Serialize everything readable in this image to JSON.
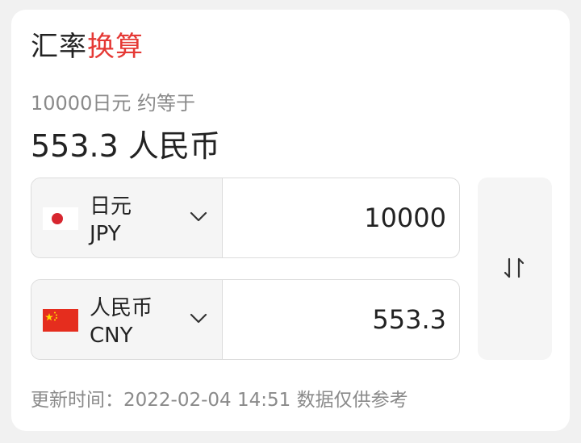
{
  "header": {
    "title_prefix": "汇率",
    "title_highlight": "换算"
  },
  "summary": {
    "description": "10000日元 约等于",
    "result": "553.3 人民币"
  },
  "converter": {
    "from": {
      "name": "日元",
      "code": "JPY",
      "amount": "10000",
      "flag": "japan-flag-icon"
    },
    "to": {
      "name": "人民币",
      "code": "CNY",
      "amount": "553.3",
      "flag": "china-flag-icon"
    },
    "swap_icon": "swap-arrows-icon"
  },
  "footer": {
    "label": "更新时间：",
    "timestamp": "2022-02-04 14:51",
    "note": "数据仅供参考"
  },
  "colors": {
    "accent": "#e53935",
    "text": "#222222",
    "muted": "#8a8a8a",
    "border": "#dcdcdc",
    "panel": "#f5f5f5"
  }
}
